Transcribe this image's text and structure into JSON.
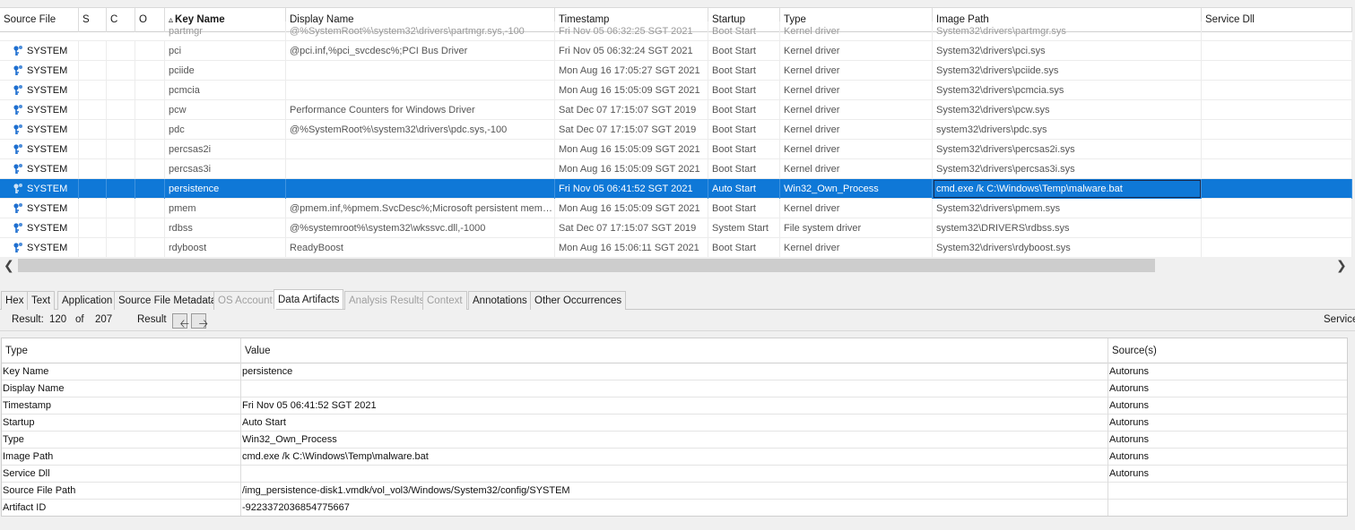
{
  "upper_table": {
    "columns": [
      "Source File",
      "S",
      "C",
      "O",
      "Key Name",
      "Display Name",
      "Timestamp",
      "Startup",
      "Type",
      "Image Path",
      "Service Dll"
    ],
    "sort_indicator": "▵",
    "partial_row": {
      "key": "partmgr",
      "display": "@%SystemRoot%\\system32\\drivers\\partmgr.sys,-100",
      "timestamp": "Fri Nov 05 06:32:25 SGT 2021",
      "startup": "Boot Start",
      "type": "Kernel driver",
      "image": "System32\\drivers\\partmgr.sys"
    },
    "rows": [
      {
        "source": "SYSTEM",
        "key": "pci",
        "display": "@pci.inf,%pci_svcdesc%;PCI Bus Driver",
        "timestamp": "Fri Nov 05 06:32:24 SGT 2021",
        "startup": "Boot Start",
        "type": "Kernel driver",
        "image": "System32\\drivers\\pci.sys",
        "dll": ""
      },
      {
        "source": "SYSTEM",
        "key": "pciide",
        "display": "",
        "timestamp": "Mon Aug 16 17:05:27 SGT 2021",
        "startup": "Boot Start",
        "type": "Kernel driver",
        "image": "System32\\drivers\\pciide.sys",
        "dll": ""
      },
      {
        "source": "SYSTEM",
        "key": "pcmcia",
        "display": "",
        "timestamp": "Mon Aug 16 15:05:09 SGT 2021",
        "startup": "Boot Start",
        "type": "Kernel driver",
        "image": "System32\\drivers\\pcmcia.sys",
        "dll": ""
      },
      {
        "source": "SYSTEM",
        "key": "pcw",
        "display": "Performance Counters for Windows Driver",
        "timestamp": "Sat Dec 07 17:15:07 SGT 2019",
        "startup": "Boot Start",
        "type": "Kernel driver",
        "image": "System32\\drivers\\pcw.sys",
        "dll": ""
      },
      {
        "source": "SYSTEM",
        "key": "pdc",
        "display": "@%SystemRoot%\\system32\\drivers\\pdc.sys,-100",
        "timestamp": "Sat Dec 07 17:15:07 SGT 2019",
        "startup": "Boot Start",
        "type": "Kernel driver",
        "image": "system32\\drivers\\pdc.sys",
        "dll": ""
      },
      {
        "source": "SYSTEM",
        "key": "percsas2i",
        "display": "",
        "timestamp": "Mon Aug 16 15:05:09 SGT 2021",
        "startup": "Boot Start",
        "type": "Kernel driver",
        "image": "System32\\drivers\\percsas2i.sys",
        "dll": ""
      },
      {
        "source": "SYSTEM",
        "key": "percsas3i",
        "display": "",
        "timestamp": "Mon Aug 16 15:05:09 SGT 2021",
        "startup": "Boot Start",
        "type": "Kernel driver",
        "image": "System32\\drivers\\percsas3i.sys",
        "dll": ""
      },
      {
        "source": "SYSTEM",
        "key": "persistence",
        "display": "",
        "timestamp": "Fri Nov 05 06:41:52 SGT 2021",
        "startup": "Auto Start",
        "type": "Win32_Own_Process",
        "image": "cmd.exe /k C:\\Windows\\Temp\\malware.bat",
        "dll": "",
        "selected": true
      },
      {
        "source": "SYSTEM",
        "key": "pmem",
        "display": "@pmem.inf,%pmem.SvcDesc%;Microsoft persistent memory disk driver",
        "timestamp": "Mon Aug 16 15:05:09 SGT 2021",
        "startup": "Boot Start",
        "type": "Kernel driver",
        "image": "System32\\drivers\\pmem.sys",
        "dll": ""
      },
      {
        "source": "SYSTEM",
        "key": "rdbss",
        "display": "@%systemroot%\\system32\\wkssvc.dll,-1000",
        "timestamp": "Sat Dec 07 17:15:07 SGT 2019",
        "startup": "System Start",
        "type": "File system driver",
        "image": "system32\\DRIVERS\\rdbss.sys",
        "dll": ""
      },
      {
        "source": "SYSTEM",
        "key": "rdyboost",
        "display": "ReadyBoost",
        "timestamp": "Mon Aug 16 15:06:11 SGT 2021",
        "startup": "Boot Start",
        "type": "Kernel driver",
        "image": "System32\\drivers\\rdyboost.sys",
        "dll": ""
      }
    ]
  },
  "tabs": [
    {
      "label": "Hex",
      "state": "normal"
    },
    {
      "label": "Text",
      "state": "normal"
    },
    {
      "label": "Application",
      "state": "normal"
    },
    {
      "label": "Source File Metadata",
      "state": "normal"
    },
    {
      "label": "OS Account",
      "state": "disabled"
    },
    {
      "label": "Data Artifacts",
      "state": "active"
    },
    {
      "label": "Analysis Results",
      "state": "disabled"
    },
    {
      "label": "Context",
      "state": "disabled"
    },
    {
      "label": "Annotations",
      "state": "normal"
    },
    {
      "label": "Other Occurrences",
      "state": "normal"
    }
  ],
  "result_bar": {
    "result_label": "Result:",
    "current": "120",
    "of_label": "of",
    "total": "207",
    "result_nav_label": "Result",
    "right_label": "Service"
  },
  "lower_table": {
    "columns": [
      "Type",
      "Value",
      "Source(s)"
    ],
    "rows": [
      {
        "type": "Key Name",
        "value": "persistence",
        "source": "Autoruns"
      },
      {
        "type": "Display Name",
        "value": "",
        "source": "Autoruns"
      },
      {
        "type": "Timestamp",
        "value": "Fri Nov 05 06:41:52 SGT 2021",
        "source": "Autoruns"
      },
      {
        "type": "Startup",
        "value": "Auto Start",
        "source": "Autoruns"
      },
      {
        "type": "Type",
        "value": "Win32_Own_Process",
        "source": "Autoruns"
      },
      {
        "type": "Image Path",
        "value": "cmd.exe /k C:\\Windows\\Temp\\malware.bat",
        "source": "Autoruns"
      },
      {
        "type": "Service Dll",
        "value": "",
        "source": "Autoruns"
      },
      {
        "type": "Source File Path",
        "value": "/img_persistence-disk1.vmdk/vol_vol3/Windows/System32/config/SYSTEM",
        "source": ""
      },
      {
        "type": "Artifact ID",
        "value": "-9223372036854775667",
        "source": ""
      }
    ]
  },
  "colors": {
    "selection": "#0f78d7",
    "registry_icon": "#1e6fd0"
  }
}
